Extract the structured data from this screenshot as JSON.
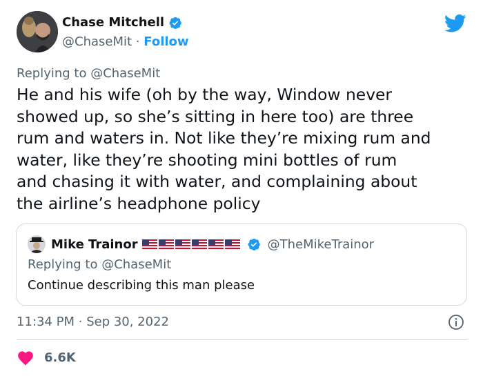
{
  "author": {
    "name": "Chase Mitchell",
    "handle": "@ChaseMit",
    "separator": "·",
    "follow_label": "Follow"
  },
  "tweet": {
    "replying_prefix": "Replying to ",
    "replying_to": "@ChaseMit",
    "text": "He and his wife (oh by the way, Window never\nshowed up, so she’s sitting in here too) are three\nrum and waters in. Not like they’re mixing rum and\nwater, like they’re shooting mini bottles of rum\nand chasing it with water, and complaining about\nthe airline’s headphone policy"
  },
  "quoted_tweet": {
    "name": "Mike Trainor",
    "handle": "@TheMikeTrainor",
    "replying_prefix": "Replying to ",
    "replying_to": "@ChaseMit",
    "text": "Continue describing this man please",
    "flag_count": 6
  },
  "meta": {
    "time": "11:34 PM",
    "separator": "·",
    "date": "Sep 30, 2022"
  },
  "engagement": {
    "likes": "6.6K"
  },
  "colors": {
    "accent": "#1d9bf0",
    "text": "#0f1419",
    "secondary": "#536471",
    "heart": "#f91880",
    "border": "#cfd9de"
  },
  "icons": {
    "verified": "verified-badge-icon",
    "brand": "twitter-bird-icon",
    "info": "info-icon",
    "like": "heart-icon",
    "flag": "us-flag-icon"
  }
}
